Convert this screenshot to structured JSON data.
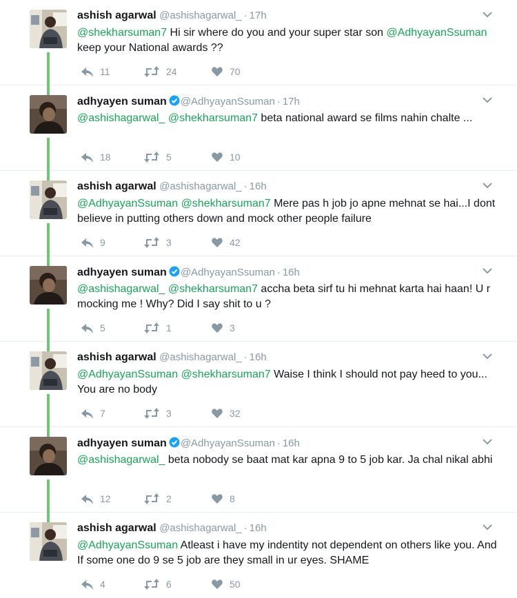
{
  "colors": {
    "mention": "#1da15a",
    "thread_line": "#71c47c",
    "meta_text": "#8899a6",
    "verified_badge": "#1da1f2"
  },
  "icons": {
    "reply": "reply-icon",
    "retweet": "retweet-icon",
    "like": "heart-icon",
    "verified": "verified-badge-icon",
    "menu": "chevron-down-icon"
  },
  "tweets": [
    {
      "name": "ashish agarwal",
      "handle": "@ashishagarwal_",
      "time": "17h",
      "verified": false,
      "text": [
        {
          "t": "@shekharsuman7",
          "m": true
        },
        {
          "t": " Hi sir where do you and your super star son ",
          "m": false
        },
        {
          "t": "@AdhyayanSsuman",
          "m": true
        },
        {
          "t": " keep your National awards  ??",
          "m": false
        }
      ],
      "replies": "11",
      "retweets": "24",
      "likes": "70"
    },
    {
      "name": "adhyayen suman",
      "handle": "@AdhyayanSsuman",
      "time": "17h",
      "verified": true,
      "text": [
        {
          "t": "@ashishagarwal_",
          "m": true
        },
        {
          "t": " ",
          "m": false
        },
        {
          "t": "@shekharsuman7",
          "m": true
        },
        {
          "t": " beta national award se films nahin chalte ...",
          "m": false
        }
      ],
      "replies": "18",
      "retweets": "5",
      "likes": "10"
    },
    {
      "name": "ashish agarwal",
      "handle": "@ashishagarwal_",
      "time": "16h",
      "verified": false,
      "text": [
        {
          "t": "@AdhyayanSsuman",
          "m": true
        },
        {
          "t": " ",
          "m": false
        },
        {
          "t": "@shekharsuman7",
          "m": true
        },
        {
          "t": " Mere pas h job jo apne mehnat se  hai...I dont believe in putting others down and mock other people failure",
          "m": false
        }
      ],
      "replies": "9",
      "retweets": "3",
      "likes": "42"
    },
    {
      "name": "adhyayen suman",
      "handle": "@AdhyayanSsuman",
      "time": "16h",
      "verified": true,
      "text": [
        {
          "t": "@ashishagarwal_",
          "m": true
        },
        {
          "t": " ",
          "m": false
        },
        {
          "t": "@shekharsuman7",
          "m": true
        },
        {
          "t": " accha beta sirf tu hi mehnat karta hai haan! U r mocking me ! Why? Did I say shit to u ?",
          "m": false
        }
      ],
      "replies": "5",
      "retweets": "1",
      "likes": "3"
    },
    {
      "name": "ashish agarwal",
      "handle": "@ashishagarwal_",
      "time": "16h",
      "verified": false,
      "text": [
        {
          "t": "@AdhyayanSsuman",
          "m": true
        },
        {
          "t": " ",
          "m": false
        },
        {
          "t": "@shekharsuman7",
          "m": true
        },
        {
          "t": " Waise I think I should not pay heed to you... You are no body",
          "m": false
        }
      ],
      "replies": "7",
      "retweets": "3",
      "likes": "32"
    },
    {
      "name": "adhyayen suman",
      "handle": "@AdhyayanSsuman",
      "time": "16h",
      "verified": true,
      "text": [
        {
          "t": "@ashishagarwal_",
          "m": true
        },
        {
          "t": "  beta nobody se baat mat kar apna 9 to 5 job kar. Ja chal nikal abhi",
          "m": false
        }
      ],
      "replies": "12",
      "retweets": "2",
      "likes": "8"
    },
    {
      "name": "ashish agarwal",
      "handle": "@ashishagarwal_",
      "time": "16h",
      "verified": false,
      "text": [
        {
          "t": "@AdhyayanSsuman",
          "m": true
        },
        {
          "t": " Atleast i have my indentity not dependent on others like you. And If some one do 9 se 5 job are they small in ur eyes. SHAME",
          "m": false
        }
      ],
      "replies": "4",
      "retweets": "6",
      "likes": "50"
    }
  ]
}
